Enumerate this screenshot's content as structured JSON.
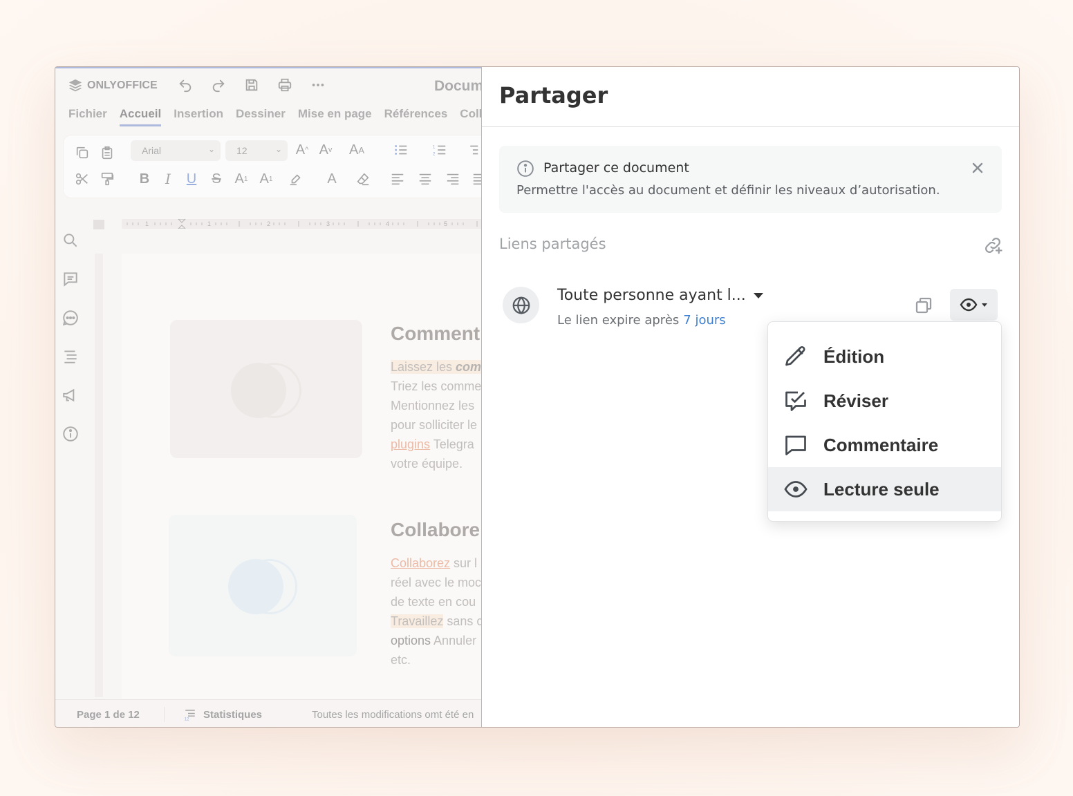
{
  "editor": {
    "app_name": "ONLYOFFICE",
    "document_title": "Docum",
    "menu_tabs": [
      {
        "label": "Fichier",
        "active": false
      },
      {
        "label": "Accueil",
        "active": true
      },
      {
        "label": "Insertion",
        "active": false
      },
      {
        "label": "Dessiner",
        "active": false
      },
      {
        "label": "Mise en page",
        "active": false
      },
      {
        "label": "Références",
        "active": false
      },
      {
        "label": "Coll",
        "active": false
      }
    ],
    "font_name": "Arial",
    "font_size": "12",
    "ruler_numbers": [
      "1",
      "1",
      "2",
      "3",
      "4",
      "5"
    ],
    "sections": [
      {
        "title": "Comment",
        "lines": [
          {
            "parts": [
              {
                "text": "Laissez les ",
                "style": "hl"
              },
              {
                "text": "com",
                "style": "hl-bold-italic"
              }
            ]
          },
          {
            "parts": [
              {
                "text": "Triez les comme",
                "style": ""
              }
            ]
          },
          {
            "parts": [
              {
                "text": "Mentionnez les",
                "style": ""
              }
            ]
          },
          {
            "parts": [
              {
                "text": "pour solliciter le",
                "style": ""
              }
            ]
          },
          {
            "parts": [
              {
                "text": "plugins",
                "style": "link"
              },
              {
                "text": " Telegra",
                "style": ""
              }
            ]
          },
          {
            "parts": [
              {
                "text": "votre équipe.",
                "style": ""
              }
            ]
          }
        ]
      },
      {
        "title": "Collabore",
        "lines": [
          {
            "parts": [
              {
                "text": "Collaborez",
                "style": "link"
              },
              {
                "text": " sur l",
                "style": ""
              }
            ]
          },
          {
            "parts": [
              {
                "text": "réel avec le moc",
                "style": ""
              }
            ]
          },
          {
            "parts": [
              {
                "text": "de texte en cou",
                "style": ""
              }
            ]
          },
          {
            "parts": [
              {
                "text": "Travaillez",
                "style": "hl"
              },
              {
                "text": " sans c",
                "style": ""
              }
            ]
          },
          {
            "parts": [
              {
                "text": "options",
                "style": "dark"
              },
              {
                "text": " Annuler",
                "style": ""
              }
            ]
          },
          {
            "parts": [
              {
                "text": "etc.",
                "style": ""
              }
            ]
          }
        ]
      }
    ],
    "status": {
      "page": "Page 1 de 12",
      "stats": "Statistiques",
      "saved": "Toutes les modifications omt été en"
    }
  },
  "share": {
    "title": "Partager",
    "info": {
      "title": "Partager ce document",
      "text": "Permettre l'accès au document et définir les niveaux d’autorisation."
    },
    "section_label": "Liens partagés",
    "link": {
      "name": "Toute personne ayant l...",
      "expire_text": "Le lien expire après",
      "expire_value": "7 jours"
    },
    "permissions": [
      {
        "label": "Édition",
        "icon": "pencil-icon",
        "selected": false
      },
      {
        "label": "Réviser",
        "icon": "review-check-icon",
        "selected": false
      },
      {
        "label": "Commentaire",
        "icon": "comment-icon",
        "selected": false
      },
      {
        "label": "Lecture seule",
        "icon": "eye-icon",
        "selected": true
      }
    ]
  },
  "colors": {
    "accent_blue": "#3d7fd1",
    "tab_underline": "#7c90c8",
    "link_orange": "#e0906e",
    "highlight": "#f5e1cf"
  }
}
